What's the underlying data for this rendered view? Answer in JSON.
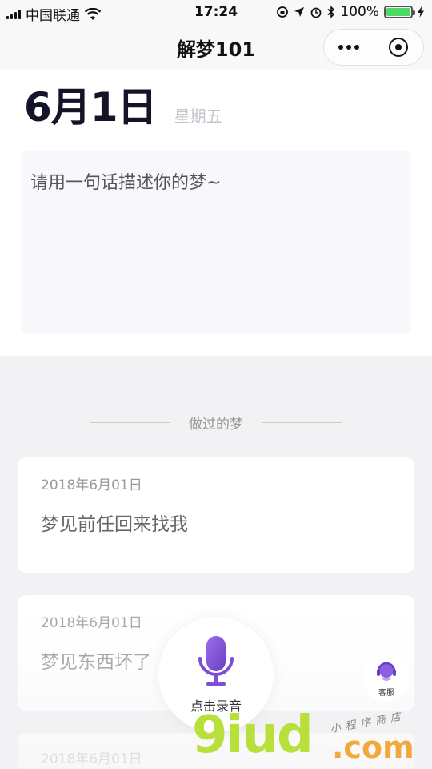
{
  "status_bar": {
    "carrier": "中国联通",
    "time": "17:24",
    "battery_percent": "100%",
    "battery_level": 1.0
  },
  "nav": {
    "title": "解梦101"
  },
  "today": {
    "date": "6月1日",
    "weekday": "星期五"
  },
  "dream_input": {
    "placeholder": "请用一句话描述你的梦~"
  },
  "history": {
    "section_title": "做过的梦",
    "items": [
      {
        "date": "2018年6月01日",
        "text": "梦见前任回来找我"
      },
      {
        "date": "2018年6月01日",
        "text": "梦见东西坏了"
      },
      {
        "date": "2018年6月01日",
        "text": ""
      }
    ]
  },
  "record_button": {
    "label": "点击录音",
    "icon": "microphone-icon"
  },
  "service_button": {
    "label": "客服",
    "icon": "headset-icon"
  },
  "watermark": {
    "brand": "9iud",
    "domain": ".com",
    "tagline": "小程序商店"
  },
  "colors": {
    "accent": "#7b4fd6",
    "background": "#f2f2f5",
    "battery": "#4cd964"
  }
}
